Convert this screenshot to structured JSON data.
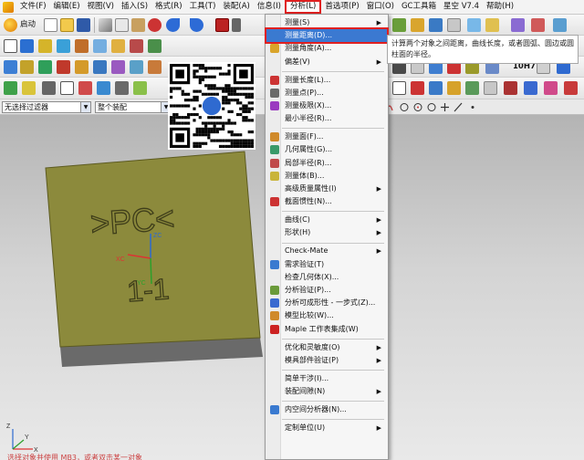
{
  "menubar": {
    "items": [
      "文件(F)",
      "编辑(E)",
      "视图(V)",
      "插入(S)",
      "格式(R)",
      "工具(T)",
      "装配(A)",
      "信息(I)",
      "分析(L)",
      "首选项(P)",
      "窗口(O)",
      "GC工具箱",
      "星空 V7.4",
      "帮助(H)"
    ],
    "active_index": 8
  },
  "toolbar": {
    "start_label": "启动",
    "tolerance_label": "10H7"
  },
  "filterbar": {
    "selection_filter": "无选择过滤器",
    "scope": "整个装配"
  },
  "analysis_menu": {
    "items": [
      {
        "label": "测量(S)",
        "submenu": true,
        "icon": "none"
      },
      {
        "label": "测量距离(D)...",
        "submenu": false,
        "icon": "measure-distance",
        "highlighted": true
      },
      {
        "label": "测量角度(A)...",
        "submenu": false,
        "icon": "measure-angle"
      },
      {
        "label": "偏差(V)",
        "submenu": true,
        "icon": "none"
      },
      {
        "label": "测量长度(L)...",
        "submenu": false,
        "icon": "measure-length"
      },
      {
        "label": "测量点(P)...",
        "submenu": false,
        "icon": "measure-point"
      },
      {
        "label": "测量极限(X)...",
        "submenu": false,
        "icon": "measure-limit"
      },
      {
        "label": "最小半径(R)...",
        "submenu": false,
        "icon": "none"
      },
      {
        "label": "测量面(F)...",
        "submenu": false,
        "icon": "measure-face"
      },
      {
        "label": "几何属性(G)...",
        "submenu": false,
        "icon": "geometry-props"
      },
      {
        "label": "局部半径(R)...",
        "submenu": false,
        "icon": "local-radius"
      },
      {
        "label": "测量体(B)...",
        "submenu": false,
        "icon": "measure-body"
      },
      {
        "label": "高级质量属性(I)",
        "submenu": true,
        "icon": "none"
      },
      {
        "label": "截面惯性(N)...",
        "submenu": false,
        "icon": "section-inertia"
      },
      {
        "label": "曲线(C)",
        "submenu": true,
        "icon": "none"
      },
      {
        "label": "形状(H)",
        "submenu": true,
        "icon": "none"
      },
      {
        "label": "Check-Mate",
        "submenu": true,
        "icon": "none"
      },
      {
        "label": "需求验证(T)",
        "submenu": false,
        "icon": "requirement"
      },
      {
        "label": "检查几何体(X)...",
        "submenu": false,
        "icon": "none"
      },
      {
        "label": "分析验证(P)...",
        "submenu": false,
        "icon": "analysis-verify"
      },
      {
        "label": "分析可成形性 - 一步式(Z)...",
        "submenu": false,
        "icon": "formability"
      },
      {
        "label": "模型比较(W)...",
        "submenu": false,
        "icon": "model-compare"
      },
      {
        "label": "Maple 工作表集成(W)",
        "submenu": false,
        "icon": "maple"
      },
      {
        "label": "优化和灵敏度(O)",
        "submenu": true,
        "icon": "none"
      },
      {
        "label": "模具部件验证(P)",
        "submenu": true,
        "icon": "none"
      },
      {
        "label": "简单干涉(I)...",
        "submenu": false,
        "icon": "none"
      },
      {
        "label": "装配间隙(N)",
        "submenu": true,
        "icon": "none"
      },
      {
        "label": "内空间分析器(N)...",
        "submenu": false,
        "icon": "space-analyzer"
      },
      {
        "label": "定制单位(U)",
        "submenu": true,
        "icon": "none"
      }
    ]
  },
  "tooltip": {
    "text": "计算两个对象之间距离，曲线长度，或者圆弧、圆边或圆柱面的半径。"
  },
  "part": {
    "engraving_top": ">PC<",
    "engraving_bottom": "1-1"
  },
  "triad": {
    "xc": "XC",
    "yc": "YC",
    "zc": "ZC"
  },
  "wcs": {
    "x": "X",
    "y": "Y",
    "z": "Z"
  },
  "status": {
    "text": "选择对象并使用 MB3，或者双击某一对象"
  },
  "colors": {
    "part_face": "#8c8a3c",
    "part_side": "#6a6a6a",
    "menu_highlight": "#3b79d1",
    "annotation_red": "#e02020"
  }
}
